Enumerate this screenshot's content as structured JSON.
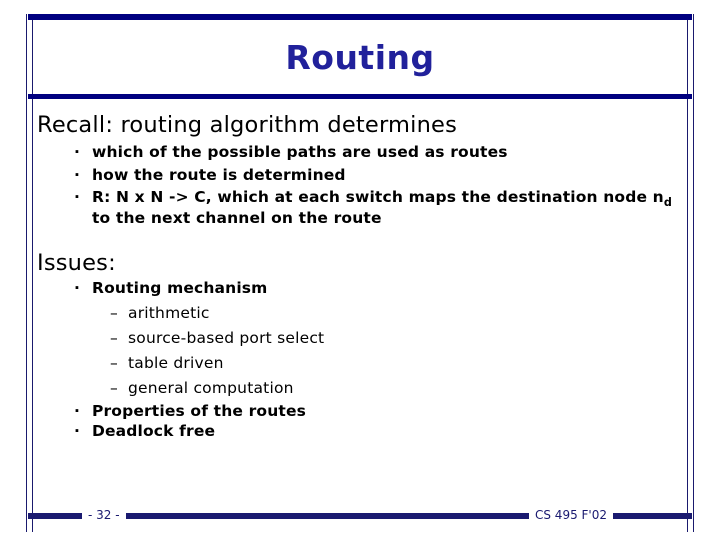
{
  "slide": {
    "title": "Routing",
    "sections": [
      {
        "heading": "Recall: routing algorithm determines",
        "bullets": [
          {
            "bullet_char": "·",
            "text": "which of the possible paths are used as routes"
          },
          {
            "bullet_char": "·",
            "text": "how the route is determined"
          },
          {
            "bullet_char": "·",
            "text_part1": "R: N x N -> C, which at each switch maps the destination node n",
            "subscript": "d",
            "text_part2": " to the next channel on the route"
          }
        ]
      },
      {
        "heading": "Issues:",
        "bullets": [
          {
            "bullet_char": "·",
            "text": "Routing mechanism",
            "subitems": [
              {
                "dash_char": "–",
                "text": "arithmetic"
              },
              {
                "dash_char": "–",
                "text": "source-based port select"
              },
              {
                "dash_char": "–",
                "text": "table driven"
              },
              {
                "dash_char": "–",
                "text": "general computation"
              }
            ]
          },
          {
            "bullet_char": "·",
            "text": "Properties of the routes"
          },
          {
            "bullet_char": "·",
            "text": "Deadlock free"
          }
        ]
      }
    ]
  },
  "footer": {
    "page_number": "- 32 -",
    "course": "CS 495 F'02"
  },
  "colors": {
    "title": "#21219b",
    "rule": "#000080",
    "frame": "#1a1a6e",
    "footer": "#1a1a70",
    "body_text": "#000000",
    "background": "#ffffff"
  }
}
